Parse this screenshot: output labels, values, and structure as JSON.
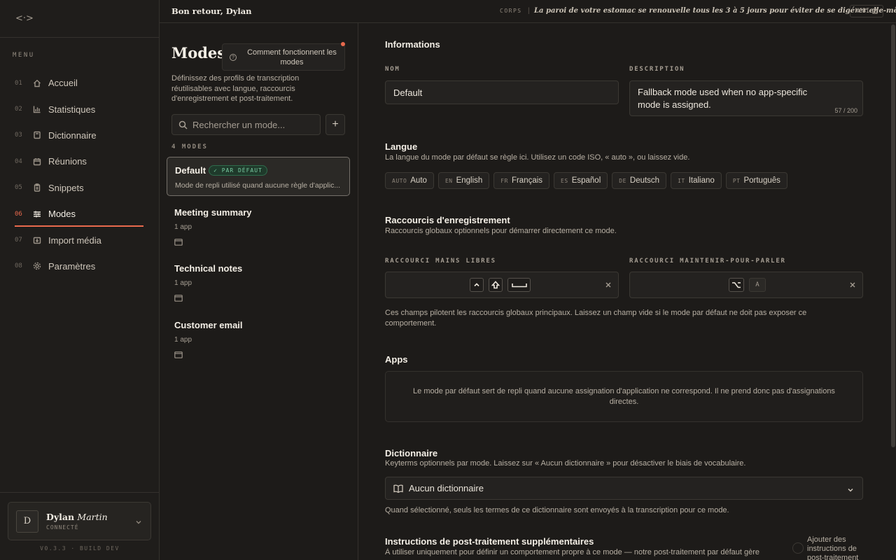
{
  "sidebar": {
    "logo": "<·>",
    "menu_label": "MENU",
    "items": [
      {
        "num": "01",
        "label": "Accueil",
        "icon": "home-icon"
      },
      {
        "num": "02",
        "label": "Statistiques",
        "icon": "bar-chart-icon"
      },
      {
        "num": "03",
        "label": "Dictionnaire",
        "icon": "book-icon"
      },
      {
        "num": "04",
        "label": "Réunions",
        "icon": "calendar-icon"
      },
      {
        "num": "05",
        "label": "Snippets",
        "icon": "clipboard-icon"
      },
      {
        "num": "06",
        "label": "Modes",
        "icon": "sliders-icon",
        "active": true
      },
      {
        "num": "07",
        "label": "Import média",
        "icon": "import-icon"
      },
      {
        "num": "08",
        "label": "Paramètres",
        "icon": "gear-icon"
      }
    ],
    "user": {
      "initial": "D",
      "first_name": "Dylan",
      "last_name": "Martin",
      "status": "CONNECTÉ"
    },
    "version": "V0.3.3 · BUILD DEV"
  },
  "topbar": {
    "greeting": "Bon retour, Dylan",
    "fact_tag": "CORPS",
    "fact_separator": "|",
    "fact_text": "La paroi de votre estomac se renouvelle tous les 3 à 5 jours pour éviter de se digérer elle-même.",
    "source_label": "NCBI"
  },
  "modes_list": {
    "title": "Modes",
    "help_button": "Comment fonctionnent les modes",
    "description": "Définissez des profils de transcription réutilisables avec langue, raccourcis d'enregistrement et post-traitement.",
    "search_placeholder": "Rechercher un mode...",
    "add_label": "+",
    "count_label": "4 MODES",
    "selected": {
      "name": "Default",
      "badge": "✓ PAR DÉFAUT",
      "subtitle": "Mode de repli utilisé quand aucune règle d'applic..."
    },
    "items": [
      {
        "name": "Meeting summary",
        "apps": "1 app"
      },
      {
        "name": "Technical notes",
        "apps": "1 app"
      },
      {
        "name": "Customer email",
        "apps": "1 app"
      }
    ]
  },
  "detail": {
    "informations": {
      "title": "Informations",
      "name_label": "NOM",
      "name_value": "Default",
      "description_label": "DESCRIPTION",
      "description_value": "Fallback mode used when no app-specific mode is assigned.",
      "char_count": "57 / 200"
    },
    "langue": {
      "title": "Langue",
      "description": "La langue du mode par défaut se règle ici. Utilisez un code ISO, « auto », ou laissez vide.",
      "chips": [
        {
          "code": "AUTO",
          "name": "Auto"
        },
        {
          "code": "EN",
          "name": "English"
        },
        {
          "code": "FR",
          "name": "Français"
        },
        {
          "code": "ES",
          "name": "Español"
        },
        {
          "code": "DE",
          "name": "Deutsch"
        },
        {
          "code": "IT",
          "name": "Italiano"
        },
        {
          "code": "PT",
          "name": "Português"
        }
      ]
    },
    "raccourcis": {
      "title": "Raccourcis d'enregistrement",
      "description": "Raccourcis globaux optionnels pour démarrer directement ce mode.",
      "hands_free_label": "RACCOURCI MAINS LIBRES",
      "push_to_talk_label": "RACCOURCI MAINTENIR-POUR-PARLER",
      "push_to_talk_key": "A",
      "note": "Ces champs pilotent les raccourcis globaux principaux. Laissez un champ vide si le mode par défaut ne doit pas exposer ce comportement."
    },
    "apps": {
      "title": "Apps",
      "message": "Le mode par défaut sert de repli quand aucune assignation d'application ne correspond. Il ne prend donc pas d'assignations directes."
    },
    "dictionnaire": {
      "title": "Dictionnaire",
      "description": "Keyterms optionnels par mode. Laissez sur « Aucun dictionnaire » pour désactiver le biais de vocabulaire.",
      "selected": "Aucun dictionnaire",
      "note": "Quand sélectionné, seuls les termes de ce dictionnaire sont envoyés à la transcription pour ce mode."
    },
    "post_traitement": {
      "title": "Instructions de post-traitement supplémentaires",
      "description": "À utiliser uniquement pour définir un comportement propre à ce mode — notre post-traitement par défaut gère",
      "toggle_label": "Ajouter des instructions de post-traitement"
    }
  },
  "colors": {
    "accent": "#e8694d",
    "badge_green": "#78c9a0",
    "background": "#1d1b19"
  }
}
